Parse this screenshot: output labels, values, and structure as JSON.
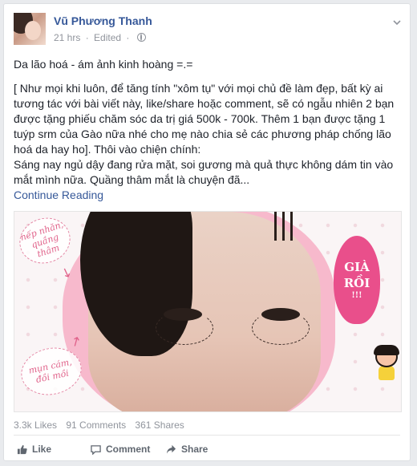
{
  "post": {
    "author": "Vũ Phương Thanh",
    "time": "21 hrs",
    "edited": "Edited",
    "separator1": "·",
    "separator2": "·",
    "menu_icon": "chevron-down-icon",
    "privacy_icon": "globe-icon",
    "title_line": "Da lão hoá - ám ảnh kinh hoàng =.=",
    "paragraph": "[ Như mọi khi luôn, để tăng tính \"xôm tụ\" với mọi chủ đề làm đẹp, bất kỳ ai tương tác với bài viết này, like/share hoặc comment, sẽ có ngẫu nhiên 2 bạn được tặng phiếu chăm sóc da trị giá 500k - 700k. Thêm 1 bạn được tặng 1 tuýp srm của Gào nữa nhé cho mẹ nào chia sẻ các phương pháp chống lão hoá da hay ho]. Thôi vào chiện chính:",
    "snippet": "Sáng nay ngủ dậy đang rửa mặt, soi gương mà quả thực không dám tin vào mắt mình nữa. Quầng thâm mắt là chuyện đã...",
    "continue": "Continue Reading"
  },
  "image": {
    "cloud_top": "nếp nhăn, quầng thâm",
    "cloud_bottom": "mụn cám, đồi mồi",
    "bubble_line1": "GIÀ",
    "bubble_line2": "RỒI",
    "bubble_ex": "!!!"
  },
  "stats": {
    "likes": "3.3k Likes",
    "comments": "91 Comments",
    "shares": "361 Shares"
  },
  "actions": {
    "like": "Like",
    "comment": "Comment",
    "share": "Share"
  },
  "colors": {
    "link": "#365899",
    "meta": "#90949c",
    "pink": "#e94f8b"
  }
}
